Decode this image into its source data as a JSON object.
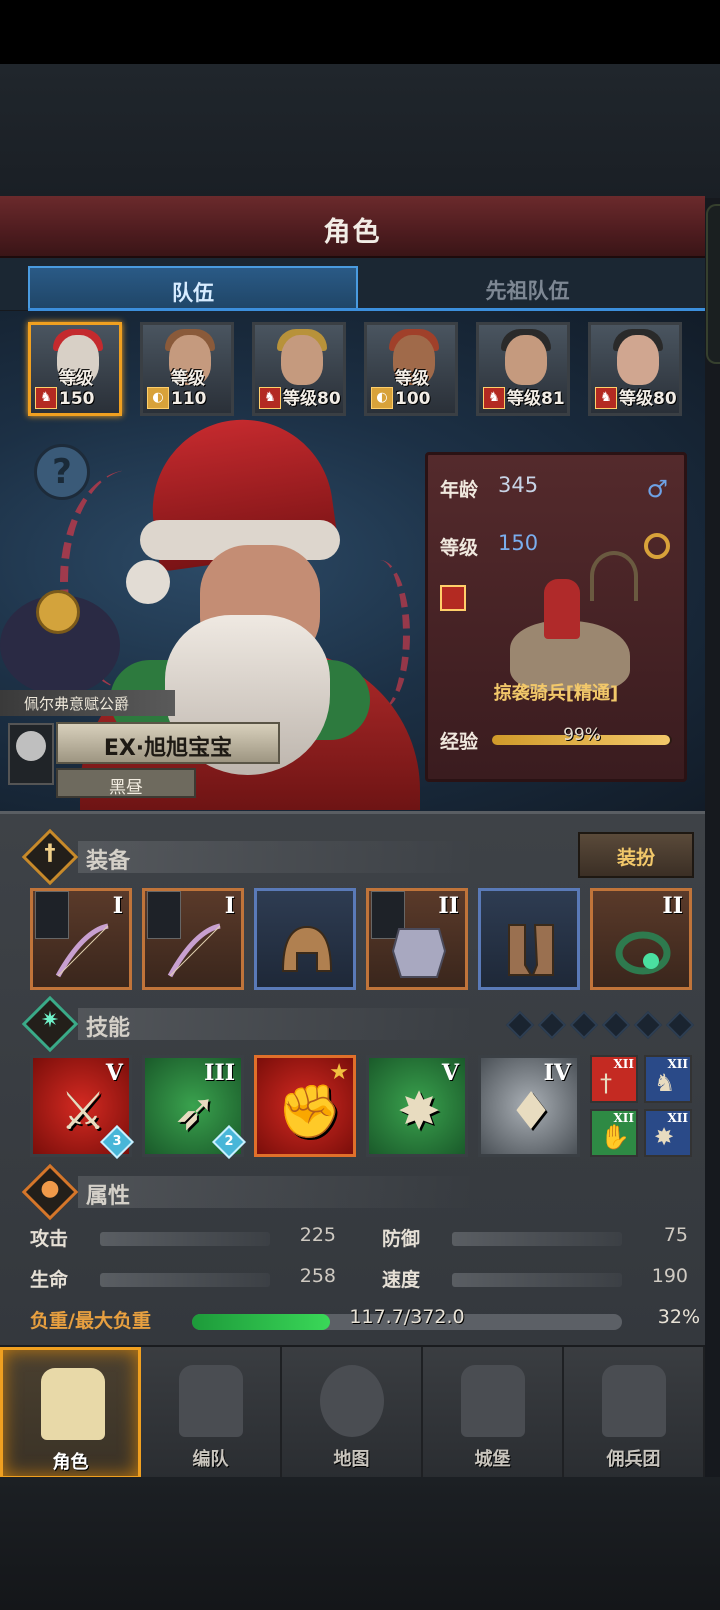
{
  "header": {
    "title": "角色"
  },
  "tabs": [
    {
      "label": "队伍",
      "active": true
    },
    {
      "label": "先祖队伍",
      "active": false
    }
  ],
  "party": [
    {
      "level": "等级150",
      "selected": true,
      "class": "cavalry"
    },
    {
      "level": "等级110",
      "selected": false,
      "class": "shield"
    },
    {
      "level": "等级80",
      "selected": false,
      "class": "cavalry"
    },
    {
      "level": "等级100",
      "selected": false,
      "class": "shield"
    },
    {
      "level": "等级81",
      "selected": false,
      "class": "cavalry"
    },
    {
      "level": "等级80",
      "selected": false,
      "class": "cavalry"
    }
  ],
  "hero": {
    "title": "佩尔弗意赋公爵",
    "name": "EX·旭旭宝宝",
    "guild": "黑昼",
    "age_label": "年龄",
    "age": "345",
    "gender_icon": "male-icon",
    "level_label": "等级",
    "level": "150",
    "unit": "掠袭骑兵[精通]",
    "xp_label": "经验",
    "xp": "99%",
    "xp_fraction": 0.99
  },
  "equipment": {
    "label": "装备",
    "dress_button": "装扮",
    "slots": [
      {
        "item": "bow",
        "tier": "I",
        "rarity": "orange",
        "banner": true
      },
      {
        "item": "bow",
        "tier": "I",
        "rarity": "orange",
        "banner": true
      },
      {
        "item": "helmet",
        "tier": "",
        "rarity": "blue",
        "banner": false
      },
      {
        "item": "armor",
        "tier": "II",
        "rarity": "orange",
        "banner": true
      },
      {
        "item": "boots",
        "tier": "",
        "rarity": "blue",
        "banner": false
      },
      {
        "item": "ring",
        "tier": "II",
        "rarity": "orange",
        "banner": false
      }
    ]
  },
  "skills": {
    "label": "技能",
    "slots": [
      {
        "tier": "V",
        "level": "3",
        "color": "red"
      },
      {
        "tier": "III",
        "level": "2",
        "color": "green"
      },
      {
        "tier": "",
        "level": "",
        "color": "orange",
        "star": true
      },
      {
        "tier": "V",
        "level": "",
        "color": "green"
      },
      {
        "tier": "IV",
        "level": "",
        "color": "grey"
      }
    ],
    "mini": [
      {
        "tier": "XII",
        "color": "red"
      },
      {
        "tier": "XII",
        "color": "blue"
      },
      {
        "tier": "XII",
        "color": "green"
      },
      {
        "tier": "XII",
        "color": "blue"
      }
    ]
  },
  "attributes": {
    "label": "属性",
    "attack_label": "攻击",
    "attack": "225",
    "defense_label": "防御",
    "defense": "75",
    "hp_label": "生命",
    "hp": "258",
    "speed_label": "速度",
    "speed": "190",
    "load_label": "负重/最大负重",
    "load": "117.7/372.0",
    "load_pct": "32%",
    "load_fraction": 0.32
  },
  "nav": [
    {
      "label": "角色",
      "active": true
    },
    {
      "label": "编队",
      "active": false
    },
    {
      "label": "地图",
      "active": false
    },
    {
      "label": "城堡",
      "active": false
    },
    {
      "label": "佣兵团",
      "active": false
    }
  ],
  "colors": {
    "accent": "#f0a020",
    "tab_active": "#3c8fdc",
    "title_bar": "#6b2a2c"
  }
}
